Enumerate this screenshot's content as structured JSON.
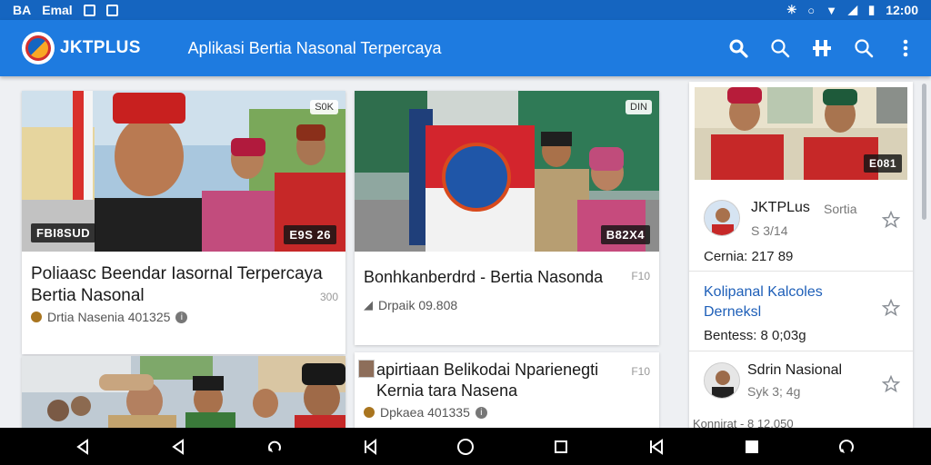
{
  "status_bar": {
    "left_text": "BA",
    "left_text2": "Emal",
    "right_time": "12:00"
  },
  "app": {
    "brand": "JKTPLUS",
    "subtitle": "Aplikasi Bertia Nasonal Terpercaya"
  },
  "toolbar": {
    "icons": [
      "search-icon",
      "search-icon",
      "hash-icon",
      "search-icon",
      "more-vert-icon"
    ]
  },
  "cards": [
    {
      "title": "Poliaasc Beendar Iasornal Terpercaya Bertia Nasonal",
      "meta": "Drtia Nasenia 401325",
      "tag_left": "FBI8SUD",
      "tag_right": "E9S 26",
      "corner": "S0K"
    },
    {
      "title": "Bonhkanberdrd - Bertia Nasonda",
      "meta": "Drpaik 09.808",
      "tag_right": "B82X4",
      "corner": "DIN",
      "aside": "F10"
    },
    {
      "title": "",
      "meta": "",
      "tag_right": ""
    },
    {
      "title": "apirtiaan Belikodai Nparienegti Kernia tara Nasena",
      "meta": "Dpkaea 401335",
      "aside": "F10"
    }
  ],
  "sidebar": {
    "photo_tag": "E081",
    "items": [
      {
        "title": "JKTPLus",
        "subtitle": "Sortia",
        "subtitle2": "S 3/14",
        "meta": "Cernia: 217 89"
      },
      {
        "title": "Kolipanal Kalcoles Derneksl",
        "meta": "Bentess: 8 0;03g"
      },
      {
        "title": "Sdrin Nasional",
        "subtitle": "Syk 3; 4g",
        "meta": "Konnirat - 8 12.050"
      }
    ]
  },
  "nav_bar": {
    "icons": [
      "back-icon",
      "back-icon",
      "undo-icon",
      "nav-icon",
      "home-icon",
      "recents-icon",
      "nav-icon",
      "square-icon",
      "refresh-icon"
    ]
  },
  "colors": {
    "status": "#1565c0",
    "appbar": "#1e7be0",
    "link": "#1e5fb8"
  }
}
